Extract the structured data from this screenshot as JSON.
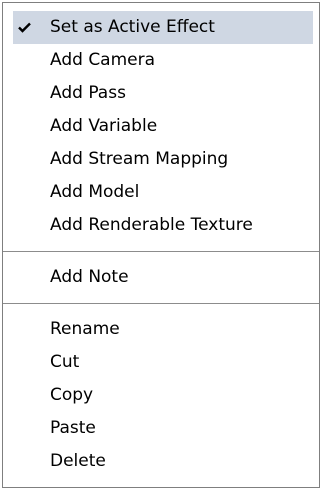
{
  "menu": {
    "group1": [
      {
        "label": "Set as Active Effect",
        "checked": true,
        "icon": "checkmark-icon"
      },
      {
        "label": "Add Camera"
      },
      {
        "label": "Add Pass"
      },
      {
        "label": "Add Variable"
      },
      {
        "label": "Add Stream Mapping"
      },
      {
        "label": "Add Model"
      },
      {
        "label": "Add Renderable Texture"
      }
    ],
    "group2": [
      {
        "label": "Add Note"
      }
    ],
    "group3": [
      {
        "label": "Rename"
      },
      {
        "label": "Cut"
      },
      {
        "label": "Copy"
      },
      {
        "label": "Paste"
      },
      {
        "label": "Delete"
      }
    ]
  },
  "colors": {
    "highlight": "#cfd7e3",
    "border": "#7f7f7f",
    "text": "#000000"
  }
}
